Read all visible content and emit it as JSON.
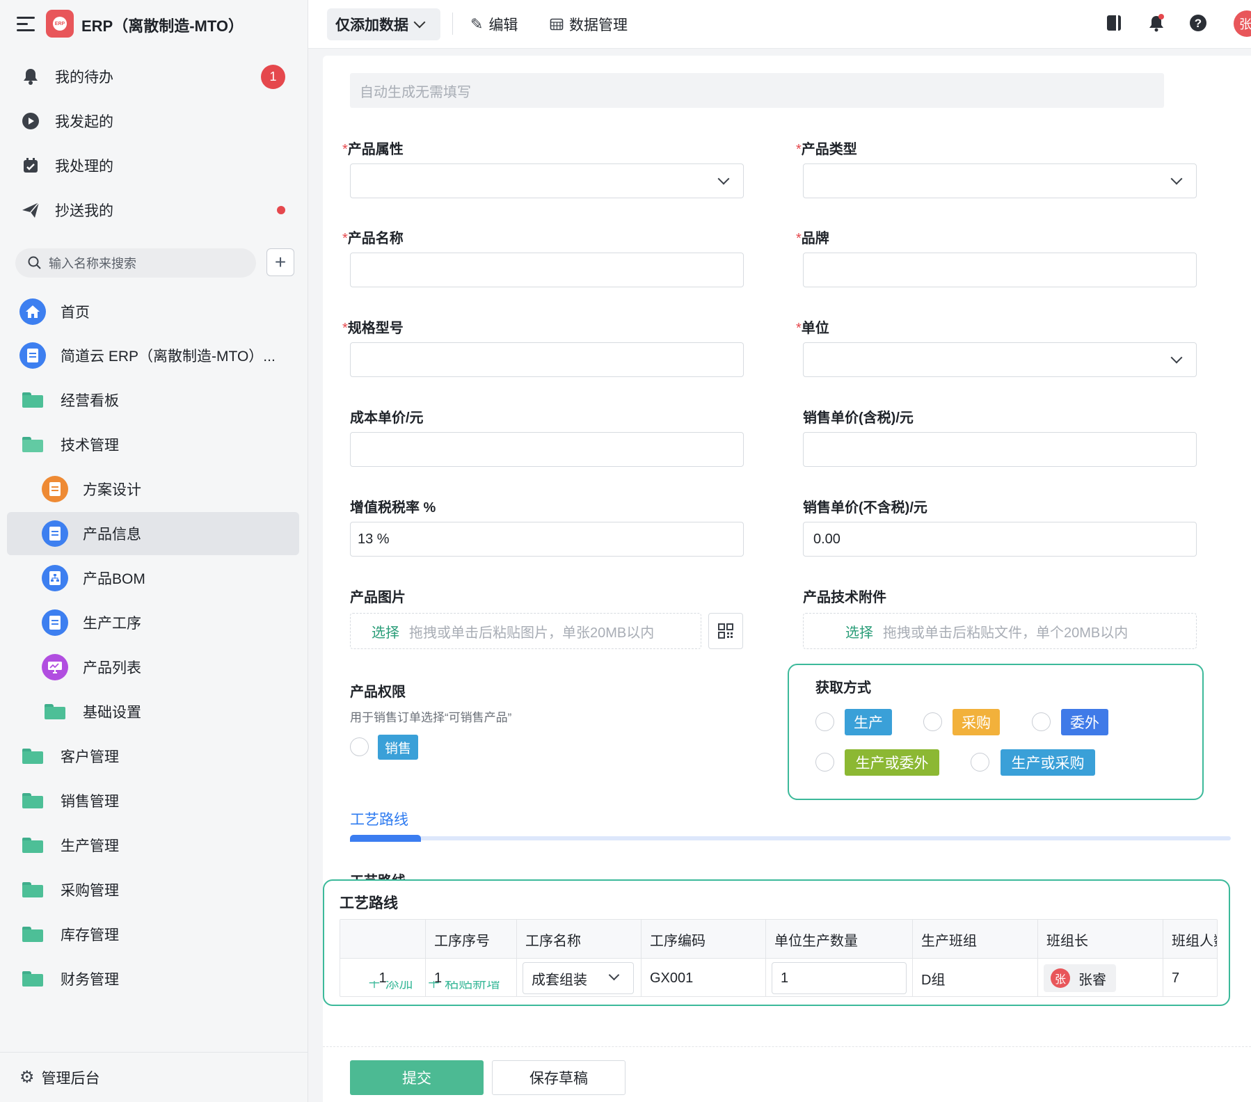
{
  "app": {
    "title": "ERP（离散制造-MTO）"
  },
  "todo": [
    {
      "label": "我的待办",
      "badge": "1"
    },
    {
      "label": "我发起的"
    },
    {
      "label": "我处理的"
    },
    {
      "label": "抄送我的"
    }
  ],
  "search": {
    "placeholder": "输入名称来搜索"
  },
  "nav": {
    "home": "首页",
    "erp_doc": "简道云 ERP（离散制造-MTO）...",
    "dashboard": "经营看板",
    "tech": "技术管理",
    "scheme": "方案设计",
    "product_info": "产品信息",
    "bom": "产品BOM",
    "process": "生产工序",
    "product_list": "产品列表",
    "base_settings": "基础设置",
    "customer": "客户管理",
    "sales": "销售管理",
    "production": "生产管理",
    "purchase": "采购管理",
    "inventory": "库存管理",
    "finance": "财务管理"
  },
  "admin": {
    "label": "管理后台"
  },
  "toolbar": {
    "mode": "仅添加数据",
    "edit": "编辑",
    "data_manage": "数据管理",
    "avatar": "张"
  },
  "form": {
    "auto_placeholder": "自动生成无需填写",
    "product_attr": "产品属性",
    "product_type": "产品类型",
    "product_name": "产品名称",
    "brand": "品牌",
    "spec": "规格型号",
    "unit": "单位",
    "cost_price": "成本单价/元",
    "sale_price_tax": "销售单价(含税)/元",
    "vat_rate": "增值税税率 %",
    "vat_rate_value": "13 %",
    "sale_price_notax": "销售单价(不含税)/元",
    "sale_price_notax_value": "0.00",
    "product_image": "产品图片",
    "upload_select": "选择",
    "image_hint": "拖拽或单击后粘贴图片，单张20MB以内",
    "tech_attach": "产品技术附件",
    "attach_hint": "拖拽或单击后粘贴文件，单个20MB以内",
    "permission": "产品权限",
    "permission_hint": "用于销售订单选择“可销售产品”",
    "permission_opt": "销售",
    "acquire": "获取方式",
    "acquire_opts": [
      "生产",
      "采购",
      "委外",
      "生产或委外",
      "生产或采购"
    ],
    "tab_route": "工艺路线",
    "route_section": "工艺路线",
    "route_behind_label": "工艺路线",
    "add_actions": "＋ 添加　＋ 粘贴新增",
    "submit": "提交",
    "save_draft": "保存草稿"
  },
  "route_table": {
    "headers": [
      "",
      "工序序号",
      "工序名称",
      "工序编码",
      "单位生产数量",
      "生产班组",
      "班组长",
      "班组人数"
    ],
    "row": {
      "index": "1",
      "seq": "1",
      "name": "成套组装",
      "code": "GX001",
      "qty": "1",
      "team": "D组",
      "leader": "张睿",
      "leader_avatar": "张",
      "members": "7"
    }
  },
  "colors": {
    "accent_green": "#4cba93",
    "tag_blue": "#3aa0d8",
    "tag_orange": "#f2b13b",
    "tag_indigo": "#3f7ae8",
    "tag_lime": "#8cb833",
    "tab_blue": "#3b7df0",
    "badge_red": "#e5484d"
  }
}
